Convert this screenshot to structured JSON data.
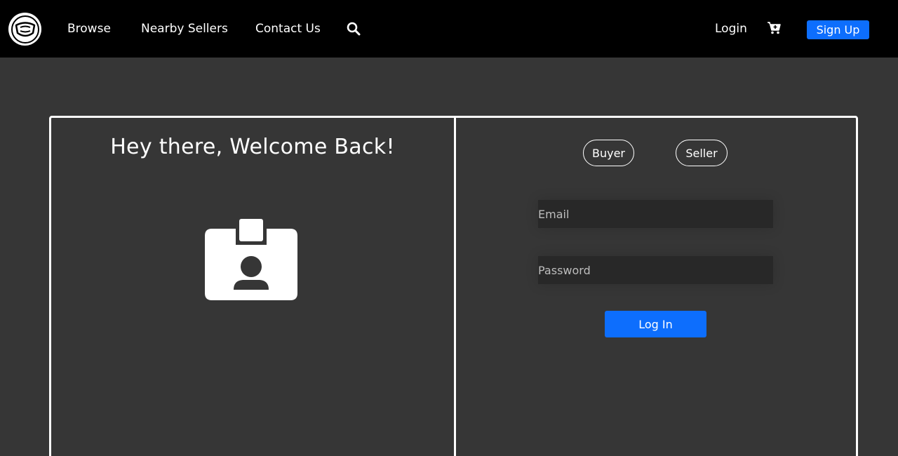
{
  "navbar": {
    "logo_icon": "face-mask-icon",
    "links": {
      "browse": "Browse",
      "nearby_sellers": "Nearby Sellers",
      "contact_us": "Contact Us"
    },
    "search_icon": "search-icon",
    "login": "Login",
    "cart_icon": "cart-plus-icon",
    "signup": "Sign Up"
  },
  "login_card": {
    "welcome_title": "Hey there, Welcome Back!",
    "illustration_icon": "id-badge-icon",
    "roles": {
      "buyer": "Buyer",
      "seller": "Seller"
    },
    "email": {
      "placeholder": "Email",
      "value": ""
    },
    "password": {
      "placeholder": "Password",
      "value": ""
    },
    "submit": "Log In"
  },
  "colors": {
    "page_background": "#363636",
    "navbar_background": "#000000",
    "accent": "#0d6efd",
    "input_background": "#282828"
  }
}
